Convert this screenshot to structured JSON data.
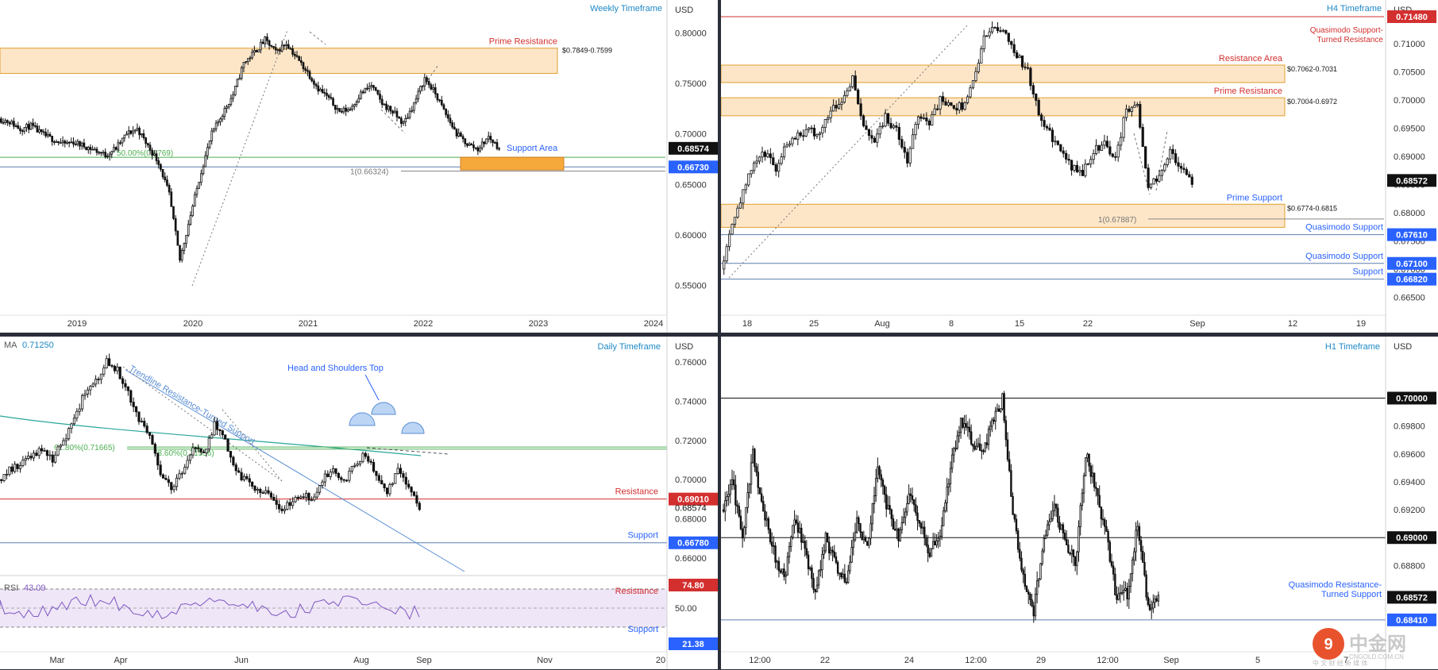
{
  "panels": {
    "weekly": {
      "title": "Weekly Timeframe",
      "currency": "USD",
      "price_ticks": [
        "0.80000",
        "0.75000",
        "0.70000",
        "0.65000",
        "0.60000",
        "0.55000"
      ],
      "time_labels": [
        "2019",
        "2020",
        "2021",
        "2022",
        "2023",
        "2024"
      ],
      "prime_resistance": {
        "label": "Prime Resistance",
        "range": "$0.7849-0.7599"
      },
      "support_area": {
        "label": "Support Area"
      },
      "fib_50": "50.00%(0.6769)",
      "ext_label": "1(0.66324)",
      "badges": {
        "last_price": "0.68574",
        "level": "0.66730"
      },
      "colors": {
        "zone": "#fde6c8",
        "support": "#f6a93b",
        "resistance_text": "#d32f2f",
        "blue_text": "#2962ff"
      }
    },
    "h4": {
      "title": "H4 Timeframe",
      "currency": "USD",
      "price_ticks": [
        "0.71000",
        "0.70500",
        "0.70000",
        "0.69500",
        "0.69000",
        "0.68500",
        "0.68000",
        "0.67500",
        "0.67000",
        "0.66500"
      ],
      "time_labels": [
        "18",
        "25",
        "Aug",
        "8",
        "15",
        "22",
        "Sep",
        "12",
        "19"
      ],
      "quasimodo_tr": "Quasimodo Support-\nTurned Resistance",
      "resistance_area": {
        "label": "Resistance Area",
        "range": "$0.7062-0.7031"
      },
      "prime_resistance": {
        "label": "Prime Resistance",
        "range": "$0.7004-0.6972"
      },
      "prime_support": {
        "label": "Prime Support",
        "range": "$0.6774-0.6815"
      },
      "ext_label": "1(0.67887)",
      "quasimodo_support_1": "Quasimodo Support",
      "quasimodo_support_2": "Quasimodo Support",
      "support": "Support",
      "badges": {
        "top": "0.71480",
        "last_price": "0.68572",
        "qs1": "0.67610",
        "qs2": "0.67100",
        "support": "0.66820"
      }
    },
    "daily": {
      "title": "Daily Timeframe",
      "currency": "USD",
      "ma_label": "MA",
      "ma_value": "0.71250",
      "price_ticks": [
        "0.76000",
        "0.74000",
        "0.72000",
        "0.70000",
        "0.68000",
        "0.66000"
      ],
      "time_labels": [
        "Mar",
        "Apr",
        "Jun",
        "Aug",
        "Sep",
        "Nov",
        "20"
      ],
      "trendline_label": "Trendline Resistance-Turned Support",
      "hs_label": "Head and Shoulders Top",
      "fib_618": "61.80%(0.71665)",
      "fib_786": "78.60%(0.71556)",
      "resistance": "Resistance",
      "support": "Support",
      "badges": {
        "resistance": "0.69010",
        "last_price": "0.68574",
        "support": "0.66780"
      },
      "rsi": {
        "label": "RSI",
        "value": "43.09",
        "resistance": "Resistance",
        "support": "Support",
        "tick_mid": "50.00",
        "badge_top": "74.80",
        "badge_bottom": "21.38"
      }
    },
    "h1": {
      "title": "H1 Timeframe",
      "currency": "USD",
      "price_ticks": [
        "0.69800",
        "0.69600",
        "0.69400",
        "0.69200",
        "0.68800"
      ],
      "time_labels": [
        "12:00",
        "22",
        "24",
        "12:00",
        "29",
        "12:00",
        "Sep",
        "5",
        "7"
      ],
      "quasimodo_label": "Quasimodo Resistance-\nTurned Support",
      "badges": {
        "top": "0.70000",
        "mid": "0.69000",
        "last_price": "0.68572",
        "bottom": "0.68410"
      }
    }
  },
  "watermark": {
    "brand": "中金网",
    "site": "CNGOLD.COM.CN",
    "tagline": "中 文 财 经 新 媒 体"
  },
  "chart_data": [
    {
      "type": "candlestick",
      "title": "Weekly Timeframe",
      "x_labels": [
        "2019",
        "2020",
        "2021",
        "2022",
        "2023",
        "2024"
      ],
      "ylim": [
        0.53,
        0.82
      ],
      "y_ticks": [
        0.8,
        0.75,
        0.7,
        0.65,
        0.6,
        0.55
      ],
      "close_path": [
        0.715,
        0.712,
        0.705,
        0.708,
        0.7,
        0.695,
        0.69,
        0.692,
        0.688,
        0.684,
        0.679,
        0.686,
        0.7,
        0.705,
        0.688,
        0.672,
        0.64,
        0.575,
        0.62,
        0.663,
        0.7,
        0.72,
        0.739,
        0.77,
        0.781,
        0.793,
        0.781,
        0.79,
        0.775,
        0.761,
        0.745,
        0.735,
        0.722,
        0.725,
        0.74,
        0.748,
        0.73,
        0.722,
        0.71,
        0.73,
        0.755,
        0.74,
        0.719,
        0.7,
        0.69,
        0.685,
        0.697,
        0.686
      ],
      "zones": [
        {
          "name": "Prime Resistance",
          "low": 0.7599,
          "high": 0.7849
        }
      ],
      "levels": [
        0.6769,
        0.66324,
        0.6673
      ],
      "last_price": 0.68574
    },
    {
      "type": "candlestick",
      "title": "H4 Timeframe",
      "x_labels": [
        "18",
        "25",
        "Aug",
        "8",
        "15",
        "22",
        "Sep",
        "12",
        "19"
      ],
      "ylim": [
        0.6635,
        0.7155
      ],
      "y_ticks": [
        0.71,
        0.705,
        0.7,
        0.695,
        0.69,
        0.685,
        0.68,
        0.675,
        0.67,
        0.665
      ],
      "close_path": [
        0.67,
        0.6785,
        0.6835,
        0.689,
        0.6905,
        0.688,
        0.6925,
        0.694,
        0.6945,
        0.694,
        0.6985,
        0.7,
        0.704,
        0.695,
        0.693,
        0.697,
        0.6945,
        0.689,
        0.6975,
        0.696,
        0.7,
        0.6985,
        0.699,
        0.703,
        0.711,
        0.713,
        0.712,
        0.708,
        0.705,
        0.6975,
        0.694,
        0.691,
        0.688,
        0.687,
        0.691,
        0.6925,
        0.6895,
        0.6985,
        0.699,
        0.685,
        0.686,
        0.6915,
        0.6875,
        0.6857
      ],
      "zones": [
        {
          "name": "Resistance Area",
          "low": 0.7031,
          "high": 0.7062
        },
        {
          "name": "Prime Resistance",
          "low": 0.6972,
          "high": 0.7004
        },
        {
          "name": "Prime Support",
          "low": 0.6774,
          "high": 0.6815
        }
      ],
      "levels": [
        0.7148,
        0.67887,
        0.6761,
        0.671,
        0.6682
      ],
      "last_price": 0.68572
    },
    {
      "type": "candlestick",
      "title": "Daily Timeframe",
      "x_labels": [
        "Mar",
        "Apr",
        "Jun",
        "Aug",
        "Sep",
        "Nov",
        "20"
      ],
      "ylim": [
        0.6515,
        0.7665
      ],
      "y_ticks": [
        0.76,
        0.74,
        0.72,
        0.7,
        0.68,
        0.66
      ],
      "close_path": [
        0.7,
        0.705,
        0.708,
        0.712,
        0.715,
        0.71,
        0.72,
        0.73,
        0.745,
        0.75,
        0.76,
        0.756,
        0.744,
        0.73,
        0.723,
        0.703,
        0.695,
        0.705,
        0.717,
        0.712,
        0.728,
        0.719,
        0.703,
        0.7,
        0.695,
        0.692,
        0.685,
        0.688,
        0.693,
        0.69,
        0.7,
        0.705,
        0.699,
        0.708,
        0.713,
        0.702,
        0.694,
        0.705,
        0.695,
        0.6857
      ],
      "moving_average": 0.7125,
      "levels": [
        0.71665,
        0.71556,
        0.6901,
        0.6678
      ],
      "last_price": 0.68574,
      "rsi": {
        "value": 43.09,
        "levels": [
          74.8,
          50.0,
          21.38
        ]
      }
    },
    {
      "type": "candlestick",
      "title": "H1 Timeframe",
      "x_labels": [
        "12:00",
        "22",
        "24",
        "12:00",
        "29",
        "12:00",
        "Sep",
        "5",
        "7"
      ],
      "ylim": [
        0.6825,
        0.7035
      ],
      "y_ticks": [
        0.698,
        0.696,
        0.694,
        0.692,
        0.688
      ],
      "close_path": [
        0.692,
        0.694,
        0.69,
        0.696,
        0.692,
        0.689,
        0.687,
        0.6915,
        0.689,
        0.686,
        0.69,
        0.688,
        0.687,
        0.691,
        0.689,
        0.695,
        0.692,
        0.69,
        0.693,
        0.691,
        0.689,
        0.69,
        0.695,
        0.6985,
        0.697,
        0.696,
        0.698,
        0.7,
        0.692,
        0.687,
        0.6848,
        0.69,
        0.692,
        0.69,
        0.688,
        0.696,
        0.6935,
        0.69,
        0.6855,
        0.686,
        0.691,
        0.685,
        0.6857
      ],
      "levels": [
        0.7,
        0.69,
        0.6841
      ],
      "last_price": 0.68572
    }
  ]
}
